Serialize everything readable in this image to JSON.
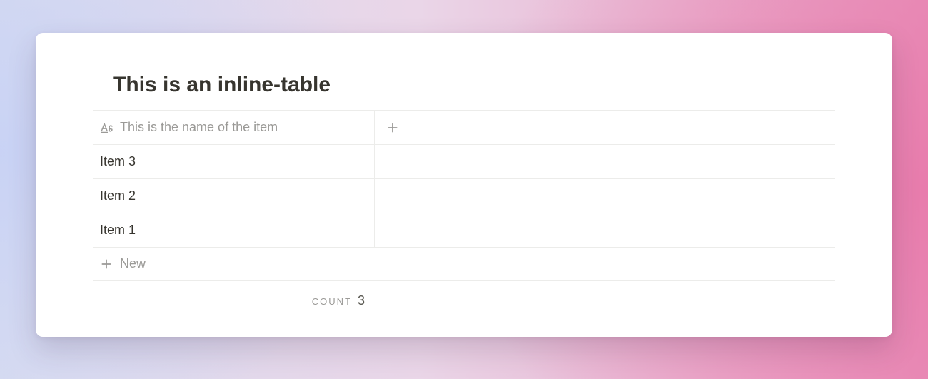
{
  "table": {
    "title": "This is an inline-table",
    "name_column_label": "This is the name of the item",
    "rows": [
      {
        "name": "Item 3"
      },
      {
        "name": "Item 2"
      },
      {
        "name": "Item 1"
      }
    ],
    "new_label": "New",
    "count_label": "Count",
    "count_value": "3"
  }
}
